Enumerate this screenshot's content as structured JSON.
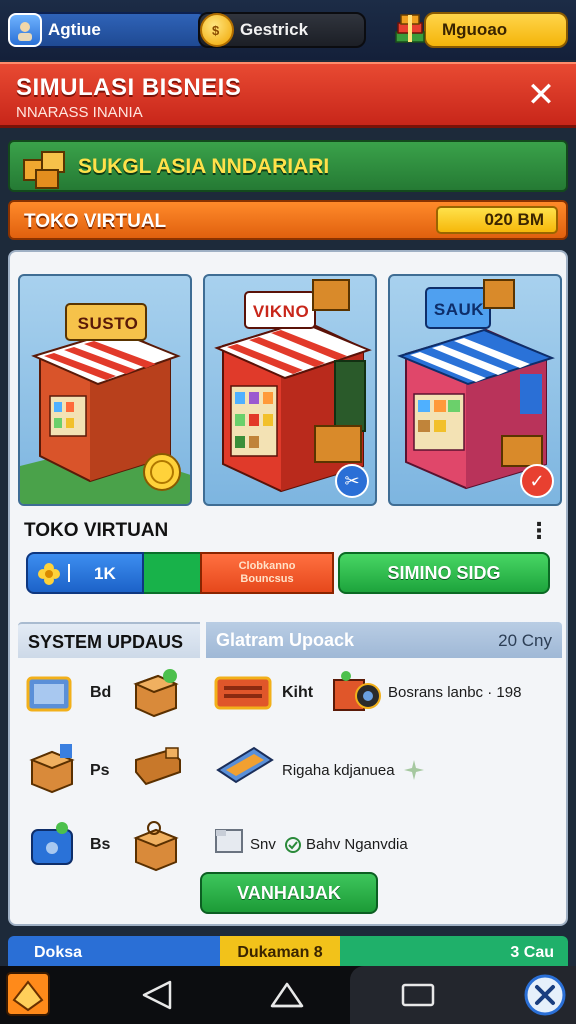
{
  "topbar": {
    "player_name": "Agtiue",
    "coins": "Gestrick",
    "gold_label": "Mguoao"
  },
  "header": {
    "title": "SIMULASI BISNEIS",
    "subtitle": "NNARASS INANIA",
    "close_glyph": "✕"
  },
  "banner": {
    "text": "SUKGL ASIA NNDARIARI"
  },
  "store_bar": {
    "label": "TOKO VIRTUAL",
    "value": "020 BM"
  },
  "shops": [
    {
      "sign": "SUSTO",
      "badge": null
    },
    {
      "sign": "VIKNO",
      "badge": "✂"
    },
    {
      "sign": "SAUK",
      "badge": "✓"
    }
  ],
  "section": {
    "title": "TOKO VIRTUAN",
    "more_glyph": "⋮",
    "count": "1K",
    "orange_line1": "Clobkanno",
    "orange_line2": "Bouncsus",
    "action_label": "SIMINO SIDG"
  },
  "system": {
    "left_title": "SYSTEM UPDAUS",
    "right_title": "Glatram Upoack",
    "right_meta": "20 Cny",
    "left_rows": [
      {
        "label": "Bd"
      },
      {
        "label": "Ps"
      },
      {
        "label": "Bs"
      }
    ],
    "right_rows": [
      {
        "label": "Kiht",
        "detail": "Bosrans lanbc · 198"
      },
      {
        "label": "Rigaha kdjanuea"
      },
      {
        "label": "Snv",
        "detail": "Bahv Nganvdia"
      }
    ],
    "cta_label": "VANHAIJAK"
  },
  "strip": {
    "left": "Doksa",
    "middle": "Dukaman 8",
    "right": "3 Cau"
  },
  "colors": {
    "header_red": "#d7321f",
    "banner_green": "#2f8f3f",
    "bar_orange": "#f07422",
    "action_green": "#24b043",
    "coin_yellow": "#ffcf3a"
  },
  "icons": [
    "avatar-icon",
    "coin-icon",
    "gift-stack-icon",
    "close-icon",
    "boxes-icon",
    "dots-icon",
    "back-icon",
    "home-icon",
    "recents-icon"
  ]
}
